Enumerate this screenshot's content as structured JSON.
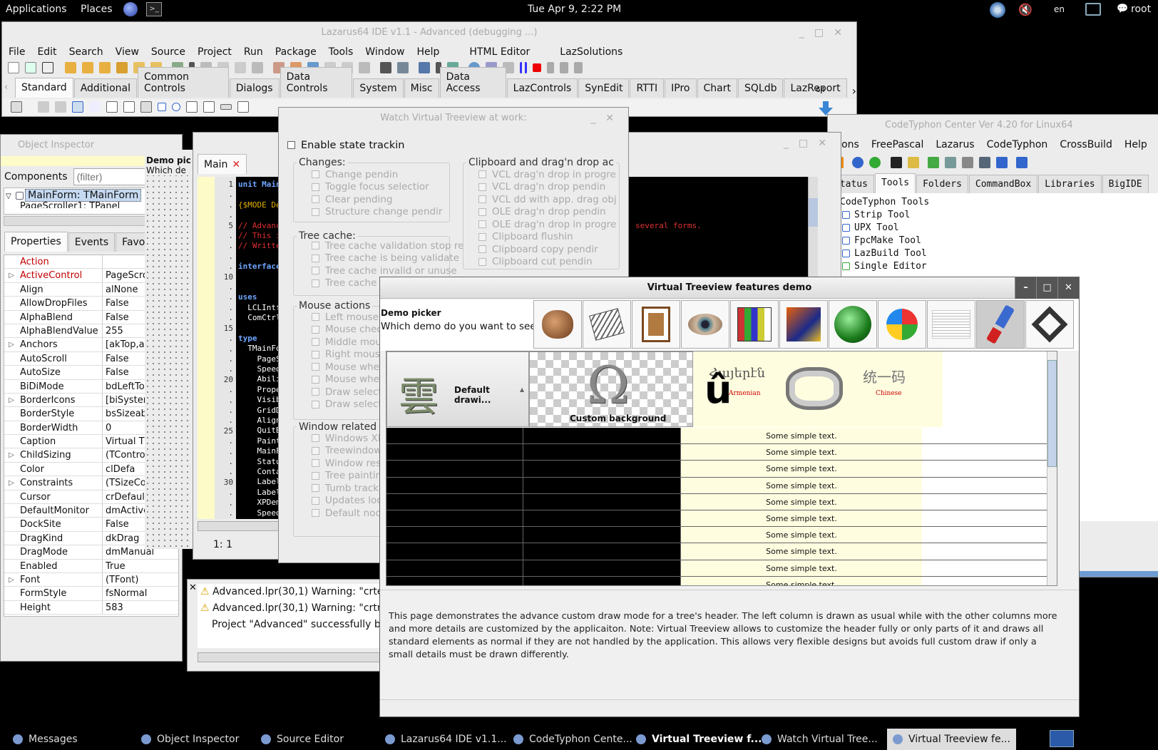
{
  "panel": {
    "applications": "Applications",
    "places": "Places",
    "clock": "Tue Apr  9,  2:22 PM",
    "lang": "en",
    "user": "root"
  },
  "lazarus": {
    "title": "Lazarus64 IDE v1.1 - Advanced (debugging ...)",
    "menu": [
      "File",
      "Edit",
      "Search",
      "View",
      "Source",
      "Project",
      "Run",
      "Package",
      "Tools",
      "Window",
      "Help",
      "HTML Editor",
      "LazSolutions"
    ],
    "palette_tabs": [
      "Standard",
      "Additional",
      "Common Controls",
      "Dialogs",
      "Data Controls",
      "System",
      "Misc",
      "Data Access",
      "LazControls",
      "SynEdit",
      "RTTI",
      "IPro",
      "Chart",
      "SQLdb",
      "LazReport"
    ],
    "bits": "64"
  },
  "inspector": {
    "title": "Object Inspector",
    "components_label": "Components",
    "filter_placeholder": "(filter)",
    "tree": [
      "MainForm: TMainForm",
      "PageScroller1: TPanel"
    ],
    "tabs": [
      "Properties",
      "Events",
      "Favori"
    ],
    "props": [
      [
        "",
        "Action",
        ""
      ],
      [
        "▷",
        "ActiveControl",
        "PageScro"
      ],
      [
        "",
        "Align",
        "alNone"
      ],
      [
        "",
        "AllowDropFiles",
        "False"
      ],
      [
        "",
        "AlphaBlend",
        "False"
      ],
      [
        "",
        "AlphaBlendValue",
        "255"
      ],
      [
        "▷",
        "Anchors",
        "[akTop,ak"
      ],
      [
        "",
        "AutoScroll",
        "False"
      ],
      [
        "",
        "AutoSize",
        "False"
      ],
      [
        "",
        "BiDiMode",
        "bdLeftTo"
      ],
      [
        "▷",
        "BorderIcons",
        "[biSyster"
      ],
      [
        "",
        "BorderStyle",
        "bsSizeab"
      ],
      [
        "",
        "BorderWidth",
        "0"
      ],
      [
        "",
        "Caption",
        "Virtual T"
      ],
      [
        "▷",
        "ChildSizing",
        "(TContro"
      ],
      [
        "",
        "Color",
        "clDefa"
      ],
      [
        "▷",
        "Constraints",
        "(TSizeCo"
      ],
      [
        "",
        "Cursor",
        "crDefaul"
      ],
      [
        "",
        "DefaultMonitor",
        "dmActive"
      ],
      [
        "",
        "DockSite",
        "False"
      ],
      [
        "",
        "DragKind",
        "dkDrag"
      ],
      [
        "",
        "DragMode",
        "dmManual"
      ],
      [
        "",
        "Enabled",
        "True"
      ],
      [
        "▷",
        "Font",
        "(TFont)"
      ],
      [
        "",
        "FormStyle",
        "fsNormal"
      ],
      [
        "",
        "Height",
        "583"
      ]
    ]
  },
  "formdesign": {
    "demo_picker": "Demo pic",
    "which": "Which de"
  },
  "editor": {
    "tab": "Main",
    "status": "1:   1",
    "lines": [
      [
        "1",
        "unit Main"
      ],
      [
        ".",
        ""
      ],
      [
        ".",
        "{$MODE De"
      ],
      [
        ".",
        ""
      ],
      [
        "5",
        "// Advanc"
      ],
      [
        ".",
        "// This i"
      ],
      [
        ".",
        "// Writte"
      ],
      [
        ".",
        ""
      ],
      [
        ".",
        "interface"
      ],
      [
        "10",
        ""
      ],
      [
        ".",
        ""
      ],
      [
        ".",
        "uses"
      ],
      [
        ".",
        "  LCLIntf"
      ],
      [
        ".",
        "  ComCtrl"
      ],
      [
        "15",
        ""
      ],
      [
        ".",
        "type"
      ],
      [
        ".",
        "  TMainFo"
      ],
      [
        ".",
        "    PageS"
      ],
      [
        ".",
        "    Speed"
      ],
      [
        "20",
        "    Abili"
      ],
      [
        ".",
        "    Prope"
      ],
      [
        ".",
        "    Visib"
      ],
      [
        ".",
        "    GridD"
      ],
      [
        ".",
        "    Align"
      ],
      [
        "25",
        "    QuitB"
      ],
      [
        ".",
        "    Paint"
      ],
      [
        ".",
        "    MainF"
      ],
      [
        ".",
        "    Statu"
      ],
      [
        ".",
        "    Conta"
      ],
      [
        "30",
        "    Label"
      ],
      [
        ".",
        "    Label"
      ],
      [
        ".",
        "    XPDem"
      ],
      [
        ".",
        "    Speed"
      ]
    ],
    "red_tail": "several forms."
  },
  "messages": {
    "lines": [
      "Advanced.lpr(30,1) Warning: \"crte",
      "Advanced.lpr(30,1) Warning: \"crtn",
      "Project \"Advanced\" successfully bu"
    ]
  },
  "watch": {
    "title": "Watch Virtual Treeview at work:",
    "enable": "Enable state trackin",
    "changes_title": "Changes:",
    "changes": [
      "Change pendin",
      "Toggle focus selectior",
      "Clear pending",
      "Structure change pendir"
    ],
    "cache_title": "Tree cache:",
    "cache": [
      "Tree cache validation stop re",
      "Tree cache is being validate",
      "Tree cache invalid or unuse",
      "Tree cache"
    ],
    "mouse_title": "Mouse actions",
    "mouse": [
      "Left mouse",
      "Mouse chec",
      "Middle mou",
      "Right mouse",
      "Mouse whe",
      "Mouse whe",
      "Draw select",
      "Draw select"
    ],
    "window_title": "Window related",
    "window": [
      "Windows XI",
      "Treewindow",
      "Window res",
      "Tree paintin",
      "Tumb track",
      "Updates loc",
      "Default noc"
    ],
    "clip_title": "Clipboard and drag'n drop ac",
    "clip": [
      "VCL drag'n drop in progre",
      "VCL drag'n drop pendin",
      "VCL dd with app. drag obj",
      "OLE drag'n drop pendin",
      "OLE drag'n drop in progre",
      "Clipboard flushin",
      "Clipboard copy pendir",
      "Clipboard cut pendin"
    ]
  },
  "codetyphon": {
    "title": "CodeTyphon Center Ver 4.20 for Linux64",
    "menu": [
      "ctions",
      "FreePascal",
      "Lazarus",
      "CodeTyphon",
      "CrossBuild",
      "Help"
    ],
    "tabs": [
      "Status",
      "Tools",
      "Folders",
      "CommandBox",
      "Libraries",
      "BigIDE"
    ],
    "tree_root": "CodeTyphon Tools",
    "tree": [
      "Strip Tool",
      "UPX Tool",
      "FpcMake Tool",
      "LazBuild Tool",
      "Single Editor"
    ]
  },
  "vtdemo": {
    "title": "Virtual Treeview features demo",
    "picker_title": "Demo picker",
    "picker_question": "Which demo do you want to see?",
    "col1": "Default drawi...",
    "col2": "Custom background",
    "armenian": "Armenian",
    "chinese": "Chinese",
    "chinese_script": "统一码",
    "row_text": "Some simple text.",
    "rows": 10,
    "description": "This page demonstrates the advance custom draw mode for a tree's header. The left column is drawn as usual while with the other columns more and more details are customized by the applicaiton. Note: Virtual Treeview allows to customize the header fully or only parts of it and draws all standard elements as normal if they are not handled by the application. This allows very flexible designs but avoids full custom draw if only a small details must be drawn differently."
  },
  "taskbar": [
    "Messages",
    "Object Inspector",
    "Source Editor",
    "Lazarus64 IDE v1.1...",
    "CodeTyphon Cente...",
    "Virtual Treeview f...",
    "Watch Virtual Tree...",
    "Virtual Treeview fe..."
  ],
  "colors": {
    "panel_bg": "#000000",
    "window_bg": "#ececec",
    "selection": "#c5d9f1",
    "editor_bg": "#000000",
    "vt_yellow": "#fffde0",
    "accent_red": "#cc0000"
  }
}
